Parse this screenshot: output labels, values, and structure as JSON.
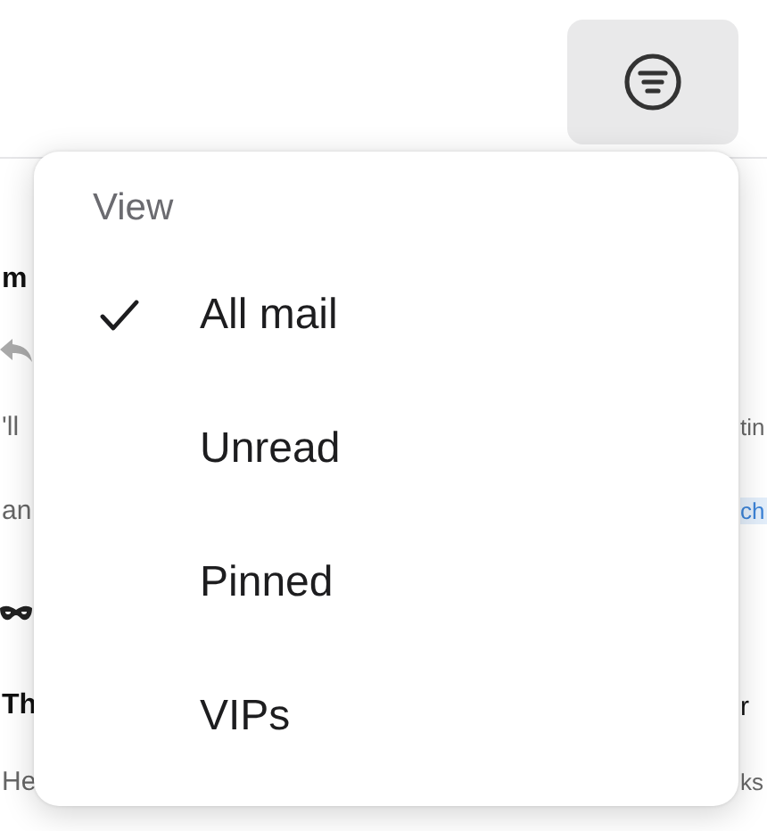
{
  "background": {
    "rows": [
      {
        "kind": "sender",
        "left": "m"
      },
      {
        "kind": "reply"
      },
      {
        "kind": "snippet",
        "left": "'ll",
        "right": "tin"
      },
      {
        "kind": "link",
        "left": "an",
        "right": "ch"
      },
      {
        "kind": "mask"
      },
      {
        "kind": "subject",
        "left": "Th",
        "right": "r"
      },
      {
        "kind": "snippet",
        "left": "He",
        "right": "ks"
      }
    ]
  },
  "menu": {
    "heading": "View",
    "items": [
      {
        "label": "All mail",
        "selected": true
      },
      {
        "label": "Unread",
        "selected": false
      },
      {
        "label": "Pinned",
        "selected": false
      },
      {
        "label": "VIPs",
        "selected": false
      }
    ]
  }
}
